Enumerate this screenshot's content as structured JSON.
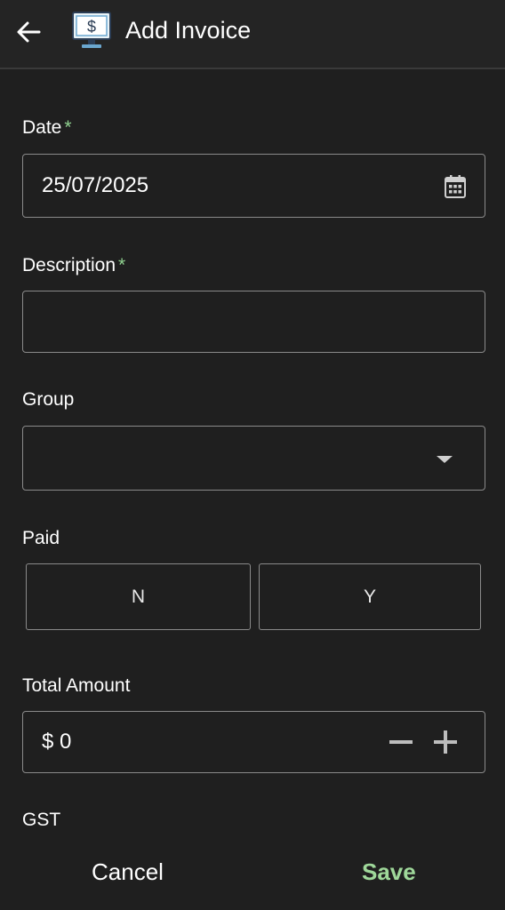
{
  "header": {
    "title": "Add Invoice",
    "back_icon": "arrow-left-icon",
    "app_icon": "monitor-dollar-icon"
  },
  "form": {
    "date": {
      "label": "Date",
      "required_mark": "*",
      "value": "25/07/2025",
      "icon": "calendar-icon"
    },
    "description": {
      "label": "Description",
      "required_mark": "*",
      "value": ""
    },
    "group": {
      "label": "Group",
      "value": "",
      "icon": "dropdown-caret-icon"
    },
    "paid": {
      "label": "Paid",
      "options": [
        "N",
        "Y"
      ]
    },
    "total_amount": {
      "label": "Total Amount",
      "currency": "$",
      "value": "0"
    },
    "gst": {
      "label": "GST"
    }
  },
  "footer": {
    "cancel_label": "Cancel",
    "save_label": "Save"
  },
  "colors": {
    "background": "#1f1f1f",
    "accent": "#9fd89a",
    "border": "#8a8a8a"
  }
}
